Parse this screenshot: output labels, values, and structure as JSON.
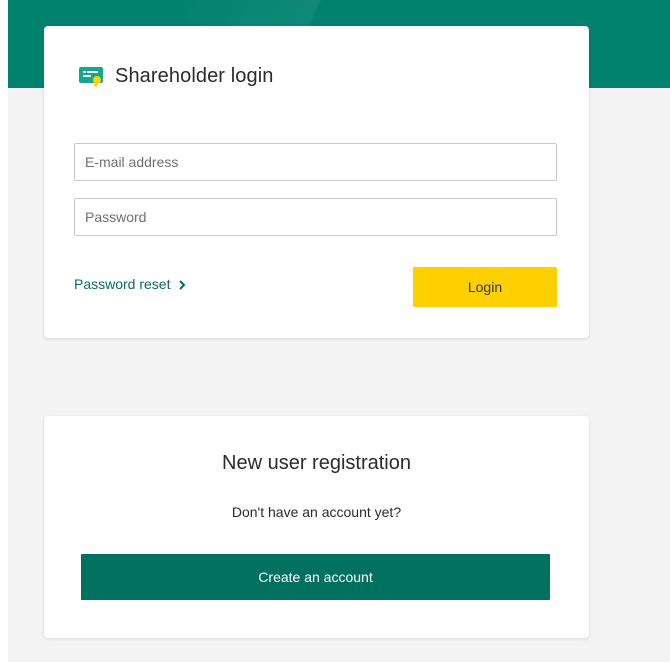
{
  "login": {
    "title": "Shareholder login",
    "icon": "certificate-icon",
    "email_placeholder": "E-mail address",
    "password_placeholder": "Password",
    "reset_label": "Password reset",
    "login_label": "Login"
  },
  "registration": {
    "title": "New user registration",
    "question": "Don't have an account yet?",
    "create_label": "Create an account"
  },
  "colors": {
    "brand_green": "#00826f",
    "button_green": "#00705f",
    "login_yellow": "#ffd000",
    "link_green": "#0a6a5d"
  }
}
